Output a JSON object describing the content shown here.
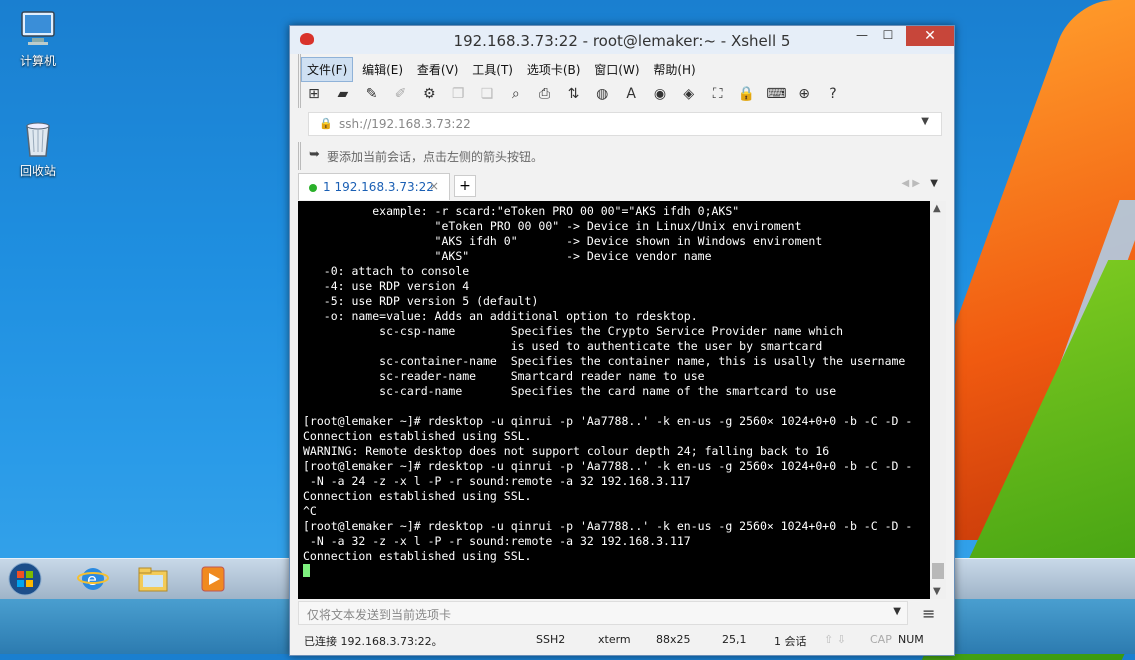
{
  "desktop": {
    "icons": [
      {
        "label": "计算机"
      },
      {
        "label": "回收站"
      }
    ]
  },
  "window": {
    "title": "192.168.3.73:22 - root@lemaker:~ - Xshell 5",
    "close_glyph": "✕",
    "minimize_glyph": "—",
    "maximize_glyph": "☐",
    "menu": [
      "文件(F)",
      "编辑(E)",
      "查看(V)",
      "工具(T)",
      "选项卡(B)",
      "窗口(W)",
      "帮助(H)"
    ],
    "address": "ssh://192.168.3.73:22",
    "hint": "要添加当前会话，点击左侧的箭头按钮。",
    "tab": {
      "label": "1 192.168.3.73:22",
      "close": "×",
      "add": "+"
    },
    "terminal_lines": [
      "          example: -r scard:\"eToken PRO 00 00\"=\"AKS ifdh 0;AKS\"",
      "                   \"eToken PRO 00 00\" -> Device in Linux/Unix enviroment",
      "                   \"AKS ifdh 0\"       -> Device shown in Windows enviroment",
      "                   \"AKS\"              -> Device vendor name",
      "   -0: attach to console",
      "   -4: use RDP version 4",
      "   -5: use RDP version 5 (default)",
      "   -o: name=value: Adds an additional option to rdesktop.",
      "           sc-csp-name        Specifies the Crypto Service Provider name which",
      "                              is used to authenticate the user by smartcard",
      "           sc-container-name  Specifies the container name, this is usally the username",
      "           sc-reader-name     Smartcard reader name to use",
      "           sc-card-name       Specifies the card name of the smartcard to use",
      "",
      "[root@lemaker ~]# rdesktop -u qinrui -p 'Aa7788..' -k en-us -g 2560× 1024+0+0 -b -C -D -",
      "Connection established using SSL.",
      "WARNING: Remote desktop does not support colour depth 24; falling back to 16",
      "[root@lemaker ~]# rdesktop -u qinrui -p 'Aa7788..' -k en-us -g 2560× 1024+0+0 -b -C -D -",
      " -N -a 24 -z -x l -P -r sound:remote -a 32 192.168.3.117",
      "Connection established using SSL.",
      "^C",
      "[root@lemaker ~]# rdesktop -u qinrui -p 'Aa7788..' -k en-us -g 2560× 1024+0+0 -b -C -D -",
      " -N -a 32 -z -x l -P -r sound:remote -a 32 192.168.3.117",
      "Connection established using SSL."
    ],
    "send_placeholder": "仅将文本发送到当前选项卡",
    "status": {
      "connected": "已连接 192.168.3.73:22。",
      "protocol": "SSH2",
      "term": "xterm",
      "size": "88x25",
      "pos": "25,1",
      "sessions": "1 会话",
      "caps": "CAP",
      "num": "NUM"
    }
  }
}
